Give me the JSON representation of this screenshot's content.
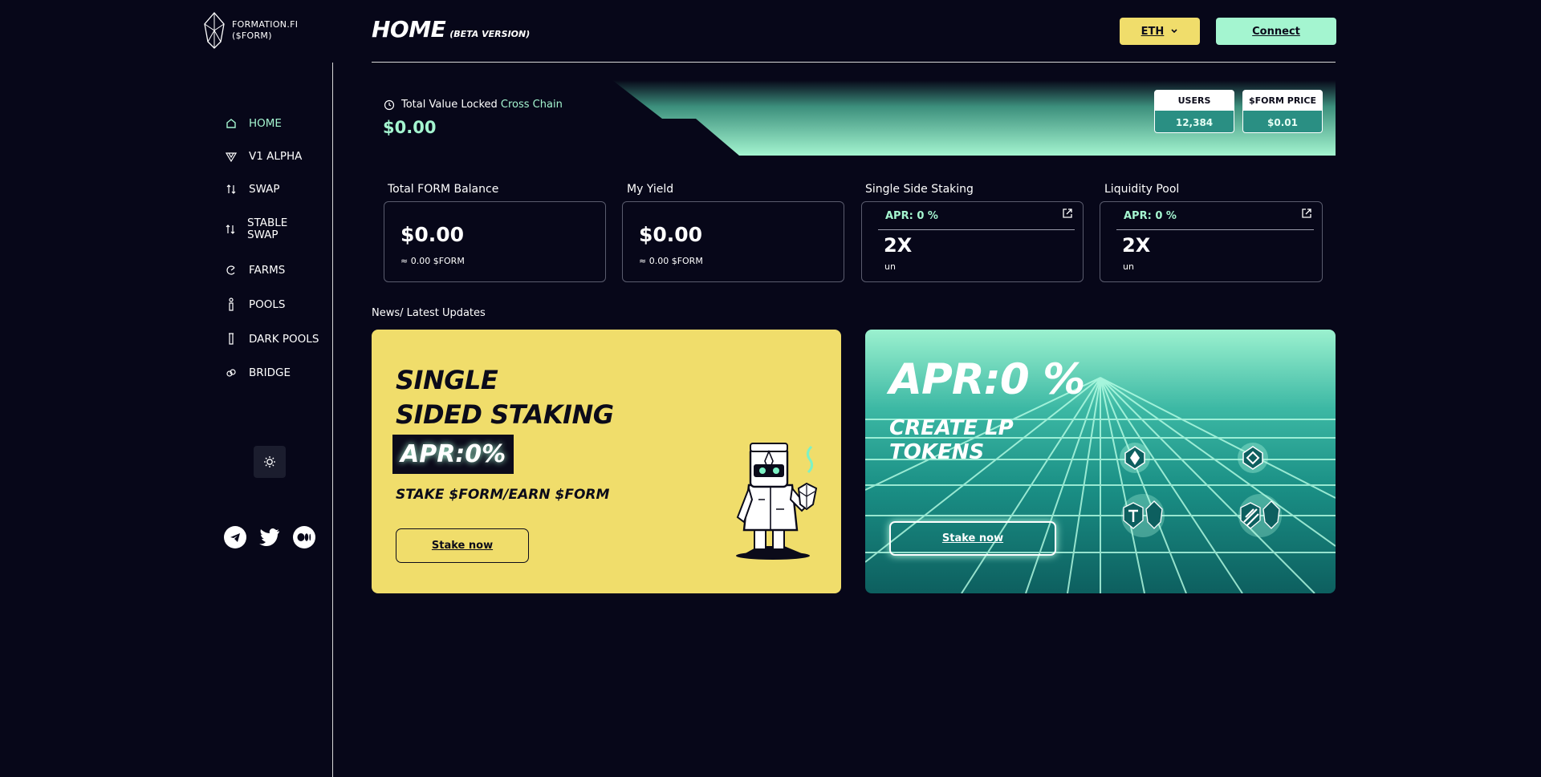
{
  "brand": {
    "name_line1": "FORMATION.FI",
    "name_line2": "($FORM)"
  },
  "sidebar": {
    "items": [
      {
        "label": "HOME",
        "icon": "home-icon",
        "active": true
      },
      {
        "label": "V1 ALPHA",
        "icon": "v1-alpha-icon",
        "active": false
      },
      {
        "label": "SWAP",
        "icon": "swap-icon",
        "active": false
      },
      {
        "label": "STABLE SWAP",
        "icon": "stable-swap-icon",
        "active": false
      },
      {
        "label": "FARMS",
        "icon": "farms-icon",
        "active": false
      },
      {
        "label": "POOLS",
        "icon": "pools-icon",
        "active": false
      },
      {
        "label": "DARK POOLS",
        "icon": "dark-pools-icon",
        "active": false
      },
      {
        "label": "BRIDGE",
        "icon": "bridge-icon",
        "active": false
      }
    ],
    "theme_toggle_icon": "sun-icon",
    "socials": [
      "telegram-icon",
      "twitter-icon",
      "medium-icon"
    ]
  },
  "header": {
    "title": "HOME",
    "subtitle": "(BETA VERSION)",
    "network": "ETH",
    "connect_label": "Connect"
  },
  "tvl": {
    "label": "Total Value Locked",
    "label_highlight": "Cross Chain",
    "value": "$0.00",
    "users_label": "USERS",
    "users_value": "12,384",
    "price_label": "$FORM PRICE",
    "price_value": "$0.01"
  },
  "stats": {
    "balance": {
      "label": "Total FORM Balance",
      "value": "$0.00",
      "sub": "≈ 0.00 $FORM"
    },
    "yield": {
      "label": "My Yield",
      "value": "$0.00",
      "sub": "≈ 0.00 $FORM"
    },
    "single": {
      "label": "Single Side Staking",
      "apr": "APR: 0 %",
      "mult": "2X",
      "unit": "un"
    },
    "lp": {
      "label": "Liquidity Pool",
      "apr": "APR: 0 %",
      "mult": "2X",
      "unit": "un"
    }
  },
  "news": {
    "label": "News/ Latest Updates",
    "staking_card": {
      "line1": "SINGLE",
      "line2": "SIDED STAKING",
      "apr": "APR:0%",
      "tagline": "STAKE $FORM/EARN $FORM",
      "button": "Stake now"
    },
    "lp_card": {
      "apr": "APR:0 %",
      "line1": "CREATE LP",
      "line2": "TOKENS",
      "button": "Stake now"
    }
  },
  "colors": {
    "background": "#070719",
    "accent": "#a4f5d0",
    "yellow": "#f0dd6b"
  }
}
